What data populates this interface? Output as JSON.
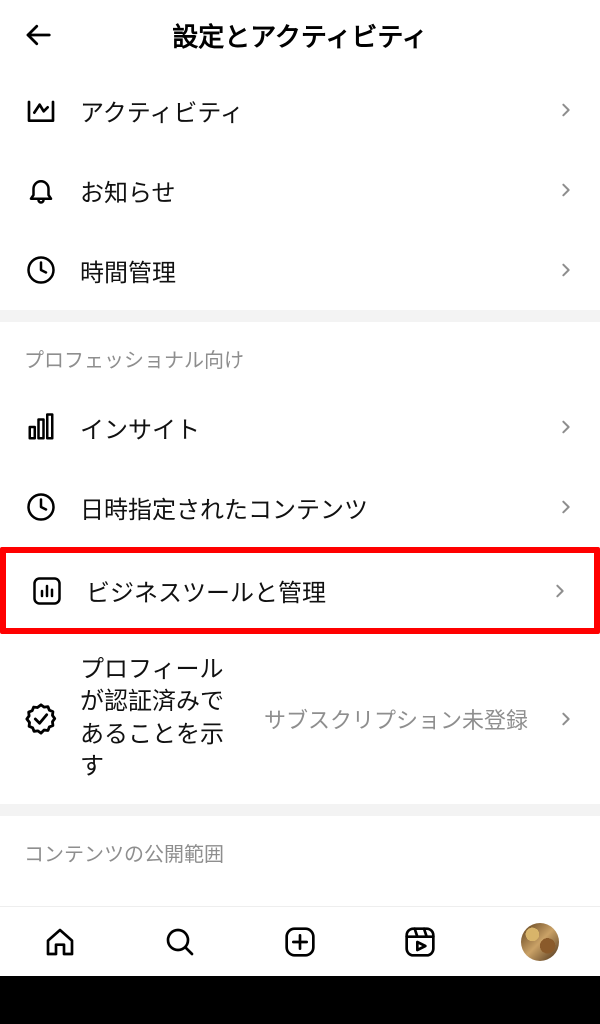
{
  "header": {
    "title": "設定とアクティビティ"
  },
  "sections": {
    "howYouUse": {
      "activity": "アクティビティ",
      "notifications": "お知らせ",
      "timeManagement": "時間管理"
    },
    "professional": {
      "header": "プロフェッショナル向け",
      "insights": "インサイト",
      "scheduledContent": "日時指定されたコンテンツ",
      "businessTools": "ビジネスツールと管理",
      "verified": {
        "label": "プロフィールが認証済みであることを示す",
        "sub": "サブスクリプション未登録"
      }
    },
    "audience": {
      "header": "コンテンツの公開範囲"
    }
  }
}
